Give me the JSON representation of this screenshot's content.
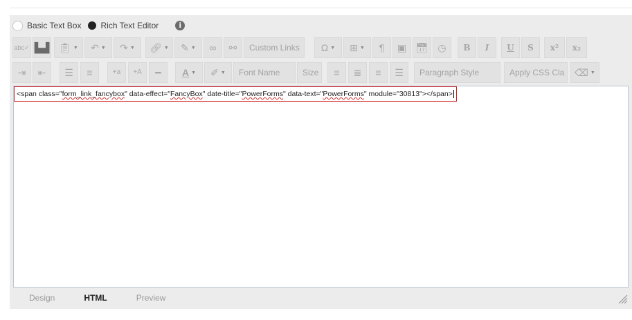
{
  "mode": {
    "basic_label": "Basic Text Box",
    "rich_label": "Rich Text Editor",
    "selected": "Rich Text Editor"
  },
  "toolbar1": {
    "buttons": [
      "spellcheck-icon",
      "find-icon",
      "paste-icon",
      "undo-icon",
      "redo-icon",
      "hyperlink-icon",
      "edit-icon",
      "link-icon",
      "unlink-icon",
      "omega-icon",
      "table-icon",
      "paragraph-icon",
      "image-icon",
      "calendar-icon",
      "clock-icon",
      "bold-icon",
      "italic-icon",
      "underline-icon",
      "strike-icon",
      "superscript-icon",
      "subscript-icon"
    ],
    "custom_links_label": "Custom Links",
    "bold_glyph": "B",
    "italic_glyph": "I",
    "underline_glyph": "U",
    "strike_glyph": "S",
    "superscript_glyph": "x²",
    "subscript_glyph": "x₂"
  },
  "toolbar2": {
    "buttons": [
      "indent-icon",
      "outdent-icon",
      "ordered-list-icon",
      "unordered-list-icon",
      "text-small-icon",
      "text-large-icon",
      "horizontal-rule-icon",
      "font-color-icon",
      "highlight-color-icon",
      "align-left-icon",
      "align-center-icon",
      "align-right-icon",
      "justify-icon",
      "eraser-icon"
    ],
    "font_name_placeholder": "Font Name",
    "size_placeholder": "Size",
    "paragraph_style_placeholder": "Paragraph Style",
    "css_class_placeholder": "Apply CSS Cla",
    "font_color_glyph": "A",
    "small_a": "+a",
    "large_a": "+A"
  },
  "content": {
    "p1": "<span class=\"",
    "p2": "form_link_fancybox",
    "p3": "\" data-effect=\"",
    "p4": "FancyBox",
    "p5": "\" date-title=\"",
    "p6": "PowerForms",
    "p7": "\" data-text=\"",
    "p8": "PowerForms",
    "p9": "\" module=\"30813\"></span>"
  },
  "tabs": {
    "design": "Design",
    "html": "HTML",
    "preview": "Preview",
    "active": "HTML"
  }
}
